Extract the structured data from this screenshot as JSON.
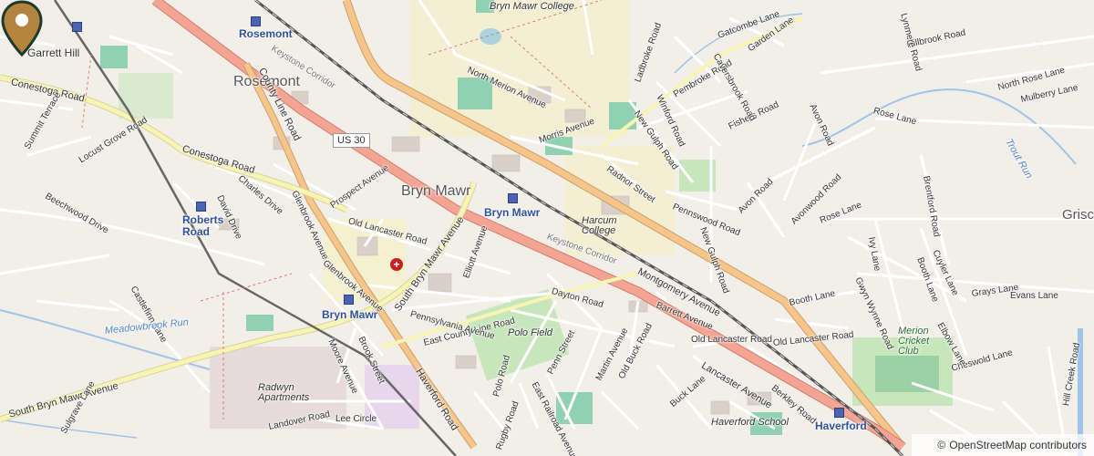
{
  "map": {
    "labels": {
      "bryn_mawr": "Bryn Mawr",
      "rosemont": "Rosemont",
      "garrett_hill": "Garrett Hill",
      "bryn_mawr_college": "Bryn Mawr College",
      "harcum_college": "Harcum College",
      "haverford_school": "Haverford School",
      "merion_cricket_club": "Merion Cricket Club",
      "polo_field": "Polo Field",
      "radwyn_apartments": "Radwyn Apartments",
      "grisco": "Grisco",
      "us30": "US 30"
    },
    "stations": {
      "rosemont": "Rosemont",
      "bryn_mawr_upper": "Bryn Mawr",
      "bryn_mawr_lower": "Bryn Mawr",
      "roberts_road": "Roberts Road",
      "haverford": "Haverford"
    },
    "roads": {
      "lancaster_avenue_1": "Lancaster Avenue",
      "montgomery_avenue": "Montgomery Avenue",
      "county_line_road": "County Line Road",
      "haverford_road": "Haverford Road",
      "south_bryn_mawr_avenue": "South Bryn Mawr Avenue",
      "south_bryn_mawr_avenue_2": "South Bryn Mawr Avenue",
      "conestoga_road": "Conestoga Road",
      "conestoga_road_2": "Conestoga Road",
      "keystone_corridor": "Keystone Corridor",
      "keystone_corridor_2": "Keystone Corridor",
      "old_lancaster_road": "Old Lancaster Road",
      "old_lancaster_road_2": "Old Lancaster Road",
      "old_lancaster_road_3": "Old Lancaster Road",
      "east_county_line_road": "East County Line Road",
      "morris_avenue": "Morris Avenue",
      "north_merion_avenue": "North Merion Avenue",
      "pennsylvania_avenue": "Pennsylvania Avenue",
      "elliott_avenue": "Elliott Avenue",
      "dayton_road": "Dayton Road",
      "penn_street": "Penn Street",
      "martin_avenue": "Martin Avenue",
      "old_buck_road": "Old Buck Road",
      "barrett_avenue": "Barrett Avenue",
      "radnor_street": "Radnor Street",
      "pennswood_road": "Pennswood Road",
      "avon_road": "Avon Road",
      "new_gulph_road": "New Gulph Road",
      "new_gulph_road_2": "New Gulph Road",
      "rose_lane": "Rose Lane",
      "rose_lane_2": "Rose Lane",
      "booth_lane": "Booth Lane",
      "grays_lane": "Grays Lane",
      "evans_lane": "Evans Lane",
      "cheswold_lane": "Cheswold Lane",
      "buck_lane": "Buck Lane",
      "berkley_road": "Berkley Road",
      "prospect_avenue": "Prospect Avenue",
      "glenbrook_avenue": "Glenbrook Avenue",
      "glenbrook_avenue_2": "Glenbrook Avenue",
      "charles_drive": "Charles Drive",
      "david_drive": "David Drive",
      "beechwood_drive": "Beechwood Drive",
      "locust_grove_road": "Locust Grove Road",
      "summit_terrace": "Summit Terrace",
      "castlefinn_lane": "Castlefinn Lane",
      "moore_avenue": "Moore Avenue",
      "brook_street": "Brook Street",
      "polo_road": "Polo Road",
      "rugby_road": "Rugby Road",
      "east_railroad_avenue": "East Railroad Avenue",
      "landover_road": "Landover Road",
      "lee_circle": "Lee Circle",
      "sulgrave_lane": "Sulgrave Lane",
      "hillbrook_road": "Hillbrook Road",
      "north_rose_lane": "North Rose Lane",
      "mulberry_lane": "Mulberry Lane",
      "fishers_road": "Fishers Road",
      "brentford_road": "Brentford Road",
      "ivy_lane": "Ivy Lane",
      "gwynwynne_road": "Gwyn Wynne Road",
      "booth_lane_2": "Booth Lane",
      "cuyler_lane": "Cuyler Lane",
      "elbow_lane": "Elbow Lane",
      "ladbroke_road": "Ladbroke Road",
      "pembroke_road": "Pembroke Road",
      "garden_lane": "Garden Lane",
      "gatcombe_lane": "Gatcombe Lane",
      "caversbrook_road": "Caversbrook Road",
      "winford_road": "Winford Road",
      "avonwood_road": "Avonwood Road",
      "avon_road_2": "Avon Road",
      "lynmere_road": "Lynmere Road",
      "hill_creek_road": "Hill Creek Road"
    },
    "water": {
      "meadowbrook_run": "Meadowbrook Run",
      "trout_run": "Trout Run"
    },
    "pin": {
      "label": "selected-location"
    },
    "attribution": {
      "symbol": "©",
      "text": "OpenStreetMap contributors"
    }
  }
}
